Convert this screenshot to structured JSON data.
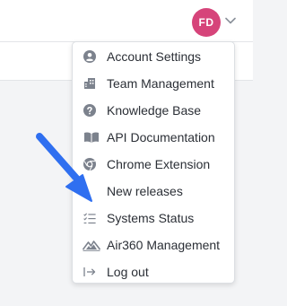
{
  "header": {
    "avatar_initials": "FD",
    "avatar_color": "#d6447a"
  },
  "menu": {
    "items": [
      {
        "label": "Account Settings",
        "icon": "user-circle-icon"
      },
      {
        "label": "Team Management",
        "icon": "building-icon"
      },
      {
        "label": "Knowledge Base",
        "icon": "help-circle-icon"
      },
      {
        "label": "API Documentation",
        "icon": "book-open-icon"
      },
      {
        "label": "Chrome Extension",
        "icon": "chrome-icon"
      },
      {
        "label": "New releases",
        "icon": "gift-icon"
      },
      {
        "label": "Systems Status",
        "icon": "checklist-icon"
      },
      {
        "label": "Air360 Management",
        "icon": "mountain-logo-icon"
      },
      {
        "label": "Log out",
        "icon": "logout-icon"
      }
    ]
  },
  "annotation": {
    "arrow_color": "#2f6ff0"
  },
  "colors": {
    "icon_gray": "#7c828d",
    "text": "#2b2f36"
  }
}
